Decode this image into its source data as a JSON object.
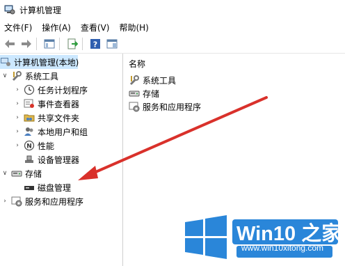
{
  "window": {
    "title": "计算机管理"
  },
  "menu": [
    "文件(F)",
    "操作(A)",
    "查看(V)",
    "帮助(H)"
  ],
  "toolbar": [
    "back-icon",
    "forward-icon",
    "show-tree-icon",
    "export-icon",
    "help-icon",
    "properties-icon"
  ],
  "tree": {
    "root": "计算机管理(本地)",
    "system_tools": "系统工具",
    "task_scheduler": "任务计划程序",
    "event_viewer": "事件查看器",
    "shared_folders": "共享文件夹",
    "local_users": "本地用户和组",
    "performance": "性能",
    "device_manager": "设备管理器",
    "storage": "存储",
    "disk_management": "磁盘管理",
    "services": "服务和应用程序"
  },
  "list": {
    "header": "名称",
    "items": [
      "系统工具",
      "存储",
      "服务和应用程序"
    ]
  },
  "watermark": {
    "brand": "Win10 之家",
    "url": "www.win10xitong.com",
    "accent": "#2a86d9"
  },
  "annotation": {
    "color": "#d9312b"
  }
}
